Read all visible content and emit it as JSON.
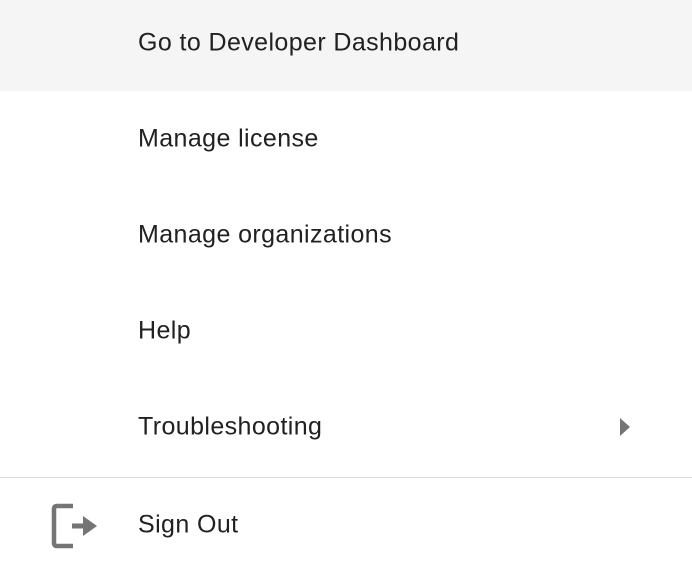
{
  "menu": {
    "items": [
      {
        "label": "Go to Developer Dashboard"
      },
      {
        "label": "Manage license"
      },
      {
        "label": "Manage organizations"
      },
      {
        "label": "Help"
      },
      {
        "label": "Troubleshooting",
        "icon": "caret-right-icon"
      }
    ],
    "sign_out": {
      "label": "Sign Out",
      "icon": "sign-out-icon"
    },
    "colors": {
      "text": "#212121",
      "icon": "#757575",
      "divider": "#dadada",
      "background": "#ffffff"
    }
  }
}
